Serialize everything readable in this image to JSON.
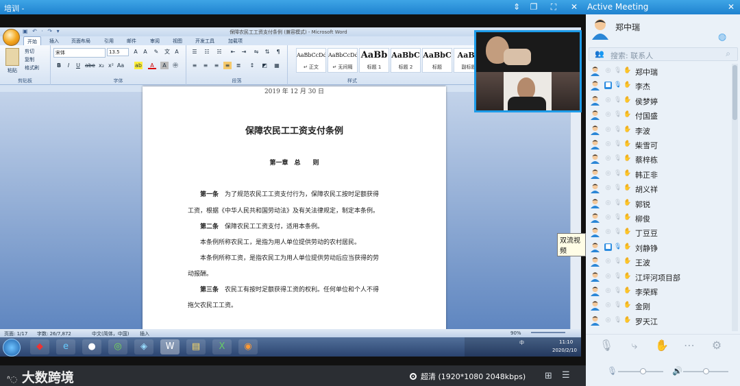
{
  "main_window": {
    "title": "培训 -",
    "controls": {
      "pin": "⇕",
      "restore": "❐",
      "fullscreen": "⛶",
      "close": "✕"
    }
  },
  "word": {
    "window_title": "保障农民工工资支付条例 (兼容模式) - Microsoft Word",
    "quick_access": "▣ ↶ · ↷ ▾",
    "tabs": [
      "开始",
      "插入",
      "页面布局",
      "引用",
      "邮件",
      "审阅",
      "视图",
      "开发工具",
      "加载项"
    ],
    "ribbon": {
      "clipboard": {
        "paste": "粘贴",
        "cut": "剪切",
        "copy": "复制",
        "painter": "格式刷",
        "label": "剪贴板"
      },
      "font": {
        "name": "宋体",
        "size": "13.5",
        "label": "字体"
      },
      "paragraph": {
        "label": "段落"
      },
      "styles": {
        "label": "样式",
        "items": [
          {
            "preview": "AaBbCcDd",
            "name": "↵ 正文"
          },
          {
            "preview": "AaBbCcDd",
            "name": "↵ 无间隔"
          },
          {
            "preview": "AaBb",
            "name": "标题 1"
          },
          {
            "preview": "AaBbC",
            "name": "标题 2"
          },
          {
            "preview": "AaBbC",
            "name": "标题"
          },
          {
            "preview": "AaBb",
            "name": "副标题"
          }
        ]
      }
    },
    "document": {
      "top_date": "2019 年 12 月 30 日",
      "title": "保障农民工工资支付条例",
      "chapter": "第一章　总　　则",
      "lines": [
        {
          "bold": "第一条",
          "text": "　为了规范农民工工资支付行为，保障农民工按时足额获得"
        },
        {
          "bold": "",
          "text": "工资，根据《中华人民共和国劳动法》及有关法律规定，制定本条例。"
        },
        {
          "bold": "第二条",
          "text": "　保障农民工工资支付，适用本条例。"
        },
        {
          "bold": "",
          "text": "本条例所称农民工，是指为用人单位提供劳动的农村居民。"
        },
        {
          "bold": "",
          "text": "本条例所称工资，是指农民工为用人单位提供劳动后应当获得的劳"
        },
        {
          "bold": "",
          "text": "动报酬。"
        },
        {
          "bold": "第三条",
          "text": "　农民工有按时足额获得工资的权利。任何单位和个人不得"
        },
        {
          "bold": "",
          "text": "拖欠农民工工资。"
        }
      ]
    },
    "statusbar": {
      "page": "页面: 1/17",
      "words": "字数: 26/7,872",
      "lang": "中文(简体，中国)",
      "mode": "插入",
      "zoom": "90%"
    },
    "taskbar": {
      "time": "11:10",
      "date": "2020/2/10",
      "ime": "中"
    }
  },
  "tooltip": "双流视频",
  "bottom_bar": {
    "watermark": "大数跨境",
    "quality_label": "超清",
    "quality_detail": "(1920*1080 2048kbps)"
  },
  "meeting": {
    "title": "Active Meeting",
    "host": "郑中瑞",
    "search_placeholder": "搜索: 联系人",
    "participants": [
      {
        "name": "郑中瑞",
        "active": false
      },
      {
        "name": "李杰",
        "active": true
      },
      {
        "name": "侯梦婷",
        "active": false
      },
      {
        "name": "付国盛",
        "active": false
      },
      {
        "name": "李波",
        "active": false
      },
      {
        "name": "柴雪可",
        "active": false
      },
      {
        "name": "蔡梓栋",
        "active": false
      },
      {
        "name": "韩正非",
        "active": false
      },
      {
        "name": "胡义祥",
        "active": false
      },
      {
        "name": "郭锐",
        "active": false
      },
      {
        "name": "柳俊",
        "active": false
      },
      {
        "name": "丁豆豆",
        "active": false
      },
      {
        "name": "刘静铮",
        "active": true
      },
      {
        "name": "王波",
        "active": false
      },
      {
        "name": "江坪河项目部",
        "active": false
      },
      {
        "name": "李荣辉",
        "active": false
      },
      {
        "name": "金刚",
        "active": false
      },
      {
        "name": "罗天江",
        "active": false
      }
    ],
    "tools": [
      "mic-off-icon",
      "share-icon",
      "raise-hand-icon",
      "more-icon",
      "settings-icon"
    ],
    "mic_level": 0.55,
    "speaker_level": 0.5
  },
  "colors": {
    "accent": "#1f82cf",
    "panel": "#eaf1f8",
    "active": "#2a8be0"
  }
}
